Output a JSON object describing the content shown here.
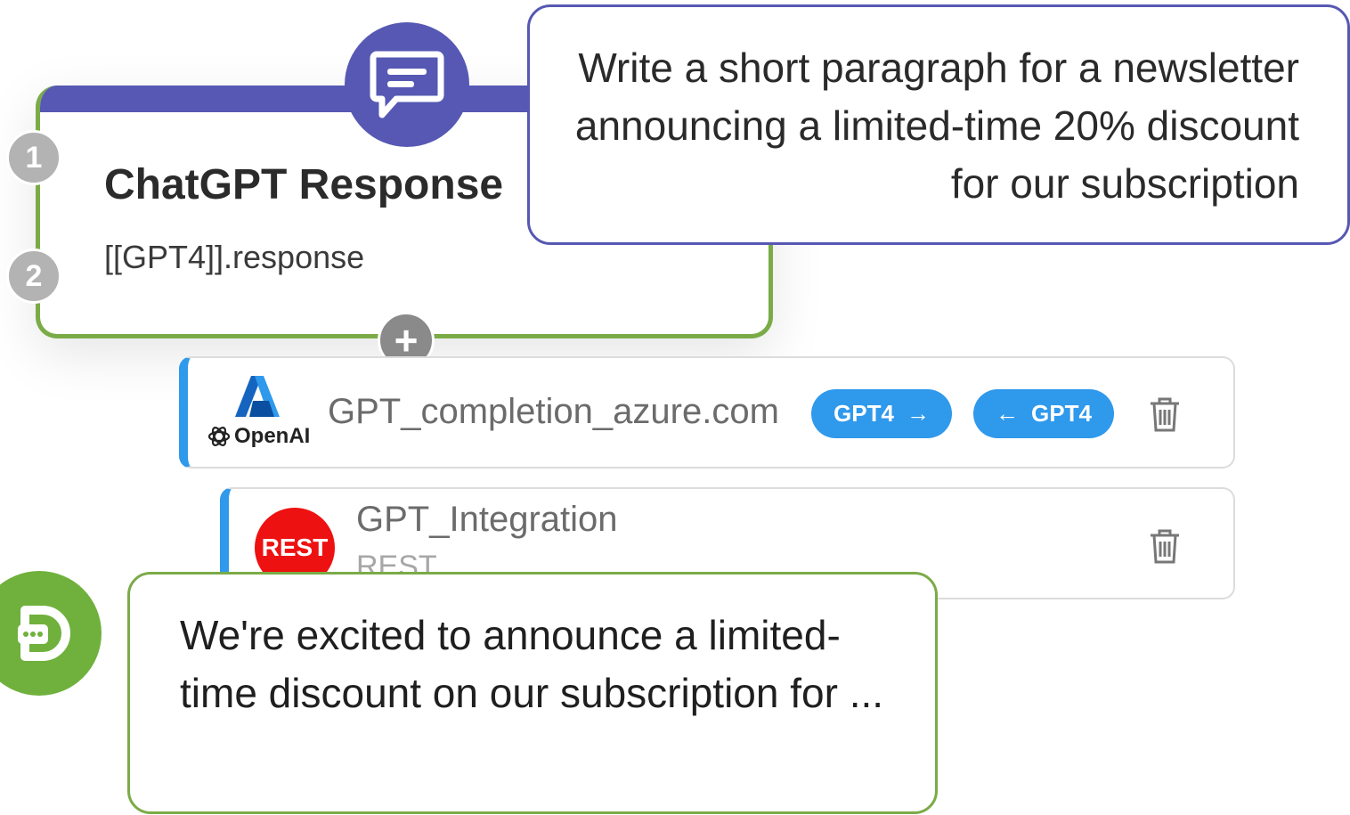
{
  "node": {
    "title": "ChatGPT Response",
    "subtitle": "[[GPT4]].response",
    "ports": [
      "1",
      "2"
    ],
    "add_symbol": "+",
    "icon": "chat-bubble-icon",
    "accent_color": "#5658b3",
    "border_color": "#7bab47"
  },
  "prompt": {
    "text": "Write a short paragraph for a newsletter announcing a limited-time 20% discount for our subscription"
  },
  "integrations": [
    {
      "name": "GPT_completion_azure.com",
      "logo_text": "OpenAI",
      "chips": [
        {
          "label": "GPT4",
          "arrow": "→"
        },
        {
          "label": "GPT4",
          "arrow": "←"
        }
      ],
      "icon": "trash-icon"
    },
    {
      "name": "GPT_Integration",
      "badge": "REST",
      "subtitle": "REST",
      "icon": "trash-icon"
    }
  ],
  "output": {
    "text": "We're excited to announce a limited-time discount on our subscription for ...",
    "icon": "chat-output-icon",
    "color": "#6fb13c"
  },
  "chip_color": "#2f99ec"
}
